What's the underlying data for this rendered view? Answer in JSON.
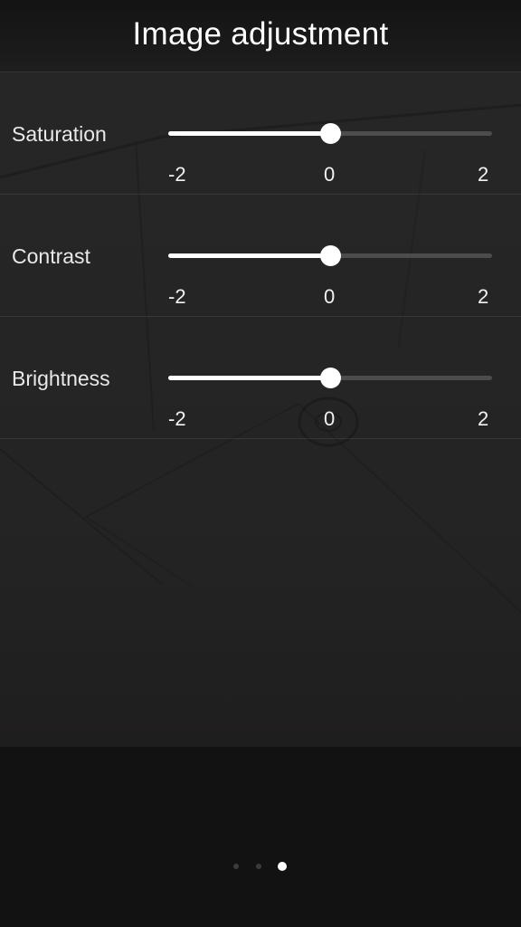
{
  "header": {
    "title": "Image adjustment"
  },
  "sliders": [
    {
      "label": "Saturation",
      "min_label": "-2",
      "mid_label": "0",
      "max_label": "2",
      "min": -2,
      "max": 2,
      "value": 0
    },
    {
      "label": "Contrast",
      "min_label": "-2",
      "mid_label": "0",
      "max_label": "2",
      "min": -2,
      "max": 2,
      "value": 0
    },
    {
      "label": "Brightness",
      "min_label": "-2",
      "mid_label": "0",
      "max_label": "2",
      "min": -2,
      "max": 2,
      "value": 0
    }
  ],
  "pager": {
    "count": 3,
    "active_index": 2
  },
  "colors": {
    "accent": "#ffffff",
    "track": "#3a3a3a",
    "background": "#121212"
  }
}
